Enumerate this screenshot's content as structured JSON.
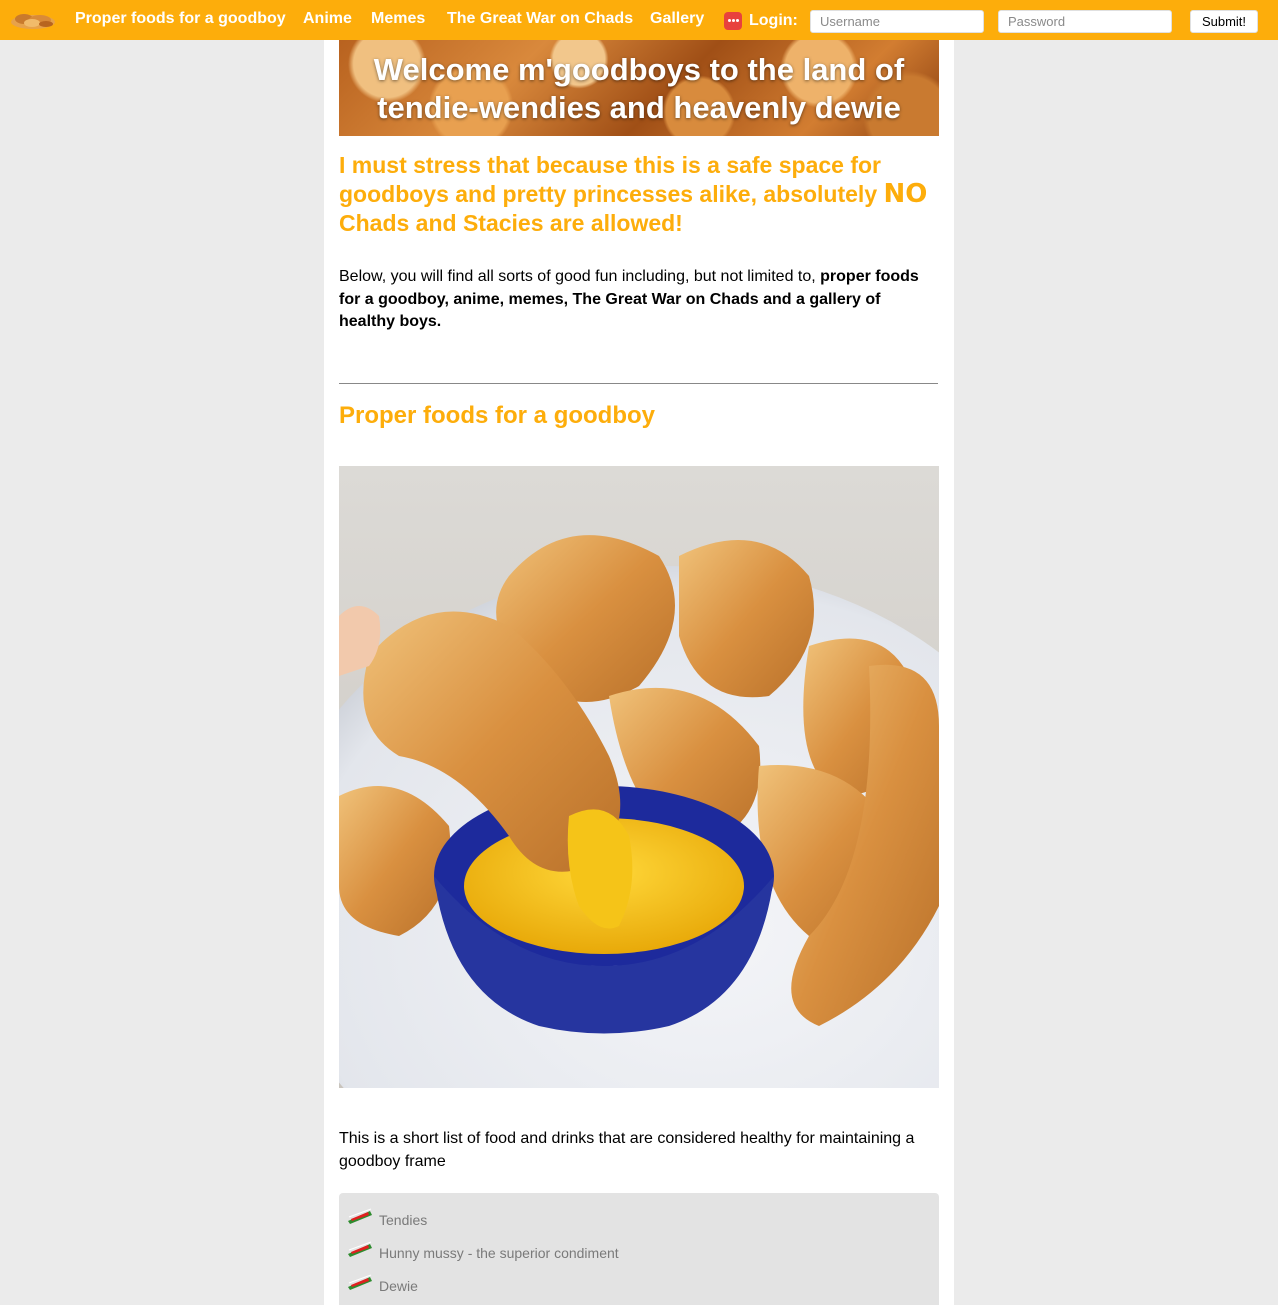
{
  "nav": {
    "links": [
      "Proper foods for a goodboy",
      "Anime",
      "Memes",
      "The Great War on Chads",
      "Gallery"
    ],
    "login_label": "Login:",
    "username_placeholder": "Username",
    "password_placeholder": "Password",
    "submit_label": "Submit!"
  },
  "hero": {
    "line1": "Welcome m'goodboys to the land of",
    "line2": "tendie-wendies and heavenly dewie"
  },
  "warning": {
    "part1": "I must stress that because this is a safe space for goodboys and pretty princesses alike, absolutely ",
    "emphasis": "NO",
    "part2": " Chads and Stacies are allowed!"
  },
  "intro": {
    "plain": "Below, you will find all sorts of good fun including, but not limited to, ",
    "bold": "proper foods for a goodboy, anime, memes, The Great War on Chads and a gallery of healthy boys."
  },
  "section": {
    "title": "Proper foods for a goodboy",
    "list_intro": "This is a short list of food and drinks that are considered healthy for maintaining a goodboy frame",
    "items": [
      "Tendies",
      "Hunny mussy - the superior condiment",
      "Dewie"
    ]
  },
  "colors": {
    "accent": "#fdad0b",
    "page_bg": "#ebebeb",
    "list_bg": "#e3e3e3"
  }
}
